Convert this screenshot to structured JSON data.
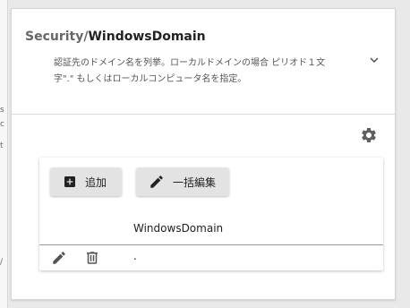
{
  "section": {
    "title_prefix": "Security/",
    "title_name": "WindowsDomain",
    "description": "認証先のドメイン名を列挙。ローカルドメインの場合 ピリオド１文字\".\" もしくはローカルコンピュータ名を指定。"
  },
  "toolbar": {
    "add_label": "追加",
    "bulk_edit_label": "一括編集"
  },
  "table": {
    "column_header": "WindowsDomain",
    "rows": [
      {
        "value": "."
      }
    ]
  },
  "left_edge": {
    "glyphs": [
      "s",
      "c",
      "t",
      "/"
    ]
  },
  "icons": {
    "expand": "chevron-down-icon",
    "settings": "gear-icon",
    "add": "add-box-icon",
    "bulk_edit": "pencil-icon",
    "row_edit": "pencil-icon",
    "row_delete": "trash-icon"
  }
}
